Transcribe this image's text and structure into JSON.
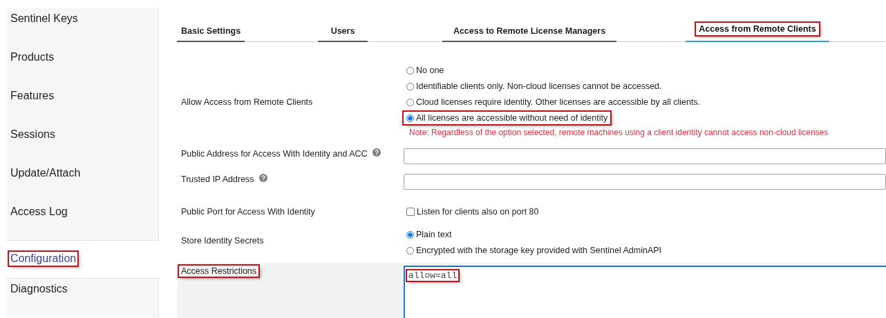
{
  "sidebar": {
    "items": [
      {
        "label": "Sentinel Keys",
        "selected": false,
        "highlighted": false
      },
      {
        "label": "Products",
        "selected": false,
        "highlighted": false
      },
      {
        "label": "Features",
        "selected": false,
        "highlighted": false
      },
      {
        "label": "Sessions",
        "selected": false,
        "highlighted": false
      },
      {
        "label": "Update/Attach",
        "selected": false,
        "highlighted": false
      },
      {
        "label": "Access Log",
        "selected": false,
        "highlighted": false
      },
      {
        "label": "Configuration",
        "selected": true,
        "highlighted": true
      },
      {
        "label": "Diagnostics",
        "selected": false,
        "highlighted": false
      }
    ]
  },
  "tabs": [
    {
      "label": "Basic Settings",
      "selected": false,
      "highlighted": false
    },
    {
      "label": "Users",
      "selected": false,
      "highlighted": false
    },
    {
      "label": "Access to Remote License Managers",
      "selected": false,
      "highlighted": false
    },
    {
      "label": "Access from Remote Clients",
      "selected": true,
      "highlighted": true
    }
  ],
  "form": {
    "rows": [
      {
        "kind": "radio",
        "label": "Allow Access from Remote Clients",
        "highlighted": false,
        "options": [
          {
            "label": "No one",
            "selected": false,
            "highlighted": false
          },
          {
            "label": "Identifiable clients only. Non-cloud licenses cannot be accessed.",
            "selected": false,
            "highlighted": false
          },
          {
            "label": "Cloud licenses require identity. Other licenses are accessible by all clients.",
            "selected": false,
            "highlighted": false
          },
          {
            "label": "All licenses are accessible without need of identity",
            "selected": true,
            "highlighted": true
          }
        ],
        "note": "Note: Regardless of the option selected, remote machines using a client identity cannot access non-cloud licenses"
      },
      {
        "kind": "text",
        "label": "Public Address for Access With Identity and ACC",
        "help": true,
        "highlighted": false
      },
      {
        "kind": "text",
        "label": "Trusted IP Address",
        "help": true,
        "highlighted": false
      },
      {
        "kind": "checkbox",
        "label": "Public Port for Access With Identity",
        "highlighted": false,
        "options": [
          {
            "label": "Listen for clients also on port 80",
            "checked": false
          }
        ]
      },
      {
        "kind": "radio",
        "label": "Store Identity Secrets",
        "highlighted": false,
        "options": [
          {
            "label": "Plain text",
            "selected": true,
            "highlighted": false
          },
          {
            "label": "Encrypted with the storage key provided with Sentinel AdminAPI",
            "selected": false,
            "highlighted": false
          }
        ]
      },
      {
        "kind": "textarea",
        "label": "Access Restrictions",
        "highlighted": true,
        "value": "allow=all",
        "value_highlighted": true
      }
    ]
  }
}
